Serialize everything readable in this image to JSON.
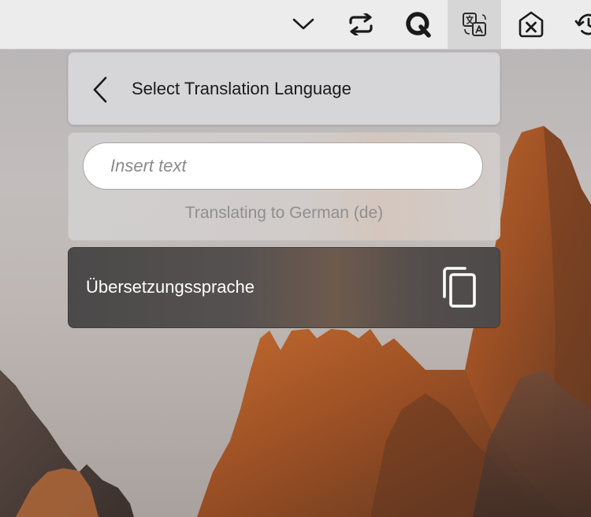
{
  "menubar": {
    "items": [
      {
        "icon": "chevron-down-icon",
        "active": false
      },
      {
        "icon": "sync-arrows-icon",
        "active": false
      },
      {
        "icon": "q-app-icon",
        "active": false
      },
      {
        "icon": "translate-icon",
        "active": true
      },
      {
        "icon": "close-box-icon",
        "active": false
      },
      {
        "icon": "history-icon",
        "active": false
      }
    ]
  },
  "popup": {
    "title": "Select Translation Language",
    "input": {
      "placeholder": "Insert text",
      "value": ""
    },
    "status": "Translating to German (de)",
    "result": "Übersetzungssprache"
  },
  "colors": {
    "menubar_bg": "#ececec",
    "active_item_bg": "#d6d6d6",
    "header_panel_bg": "#d6d6d8",
    "result_panel_bg": "#4d4a4a",
    "result_text": "#ffffff",
    "status_text": "#8f8f8f"
  }
}
